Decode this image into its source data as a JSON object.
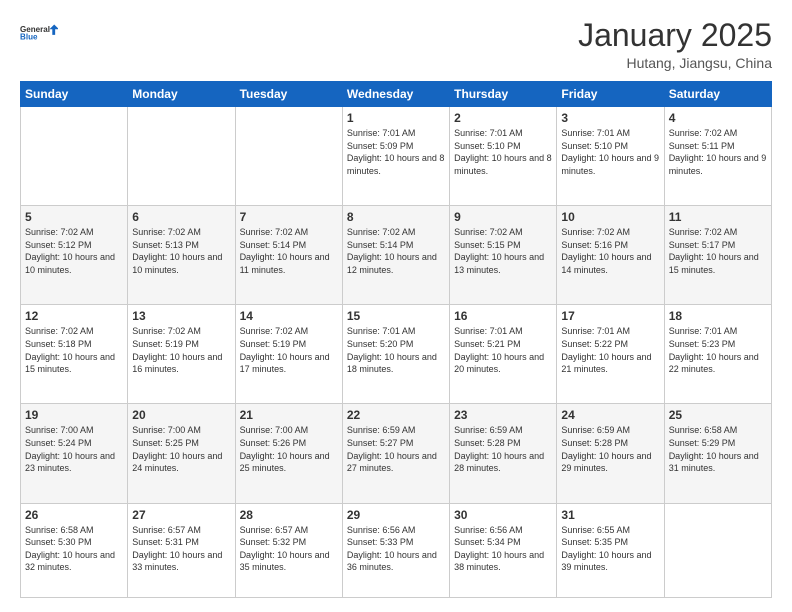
{
  "header": {
    "logo_text_general": "General",
    "logo_text_blue": "Blue",
    "month": "January 2025",
    "location": "Hutang, Jiangsu, China"
  },
  "days_of_week": [
    "Sunday",
    "Monday",
    "Tuesday",
    "Wednesday",
    "Thursday",
    "Friday",
    "Saturday"
  ],
  "weeks": [
    [
      {
        "num": "",
        "info": ""
      },
      {
        "num": "",
        "info": ""
      },
      {
        "num": "",
        "info": ""
      },
      {
        "num": "1",
        "info": "Sunrise: 7:01 AM\nSunset: 5:09 PM\nDaylight: 10 hours and 8 minutes."
      },
      {
        "num": "2",
        "info": "Sunrise: 7:01 AM\nSunset: 5:10 PM\nDaylight: 10 hours and 8 minutes."
      },
      {
        "num": "3",
        "info": "Sunrise: 7:01 AM\nSunset: 5:10 PM\nDaylight: 10 hours and 9 minutes."
      },
      {
        "num": "4",
        "info": "Sunrise: 7:02 AM\nSunset: 5:11 PM\nDaylight: 10 hours and 9 minutes."
      }
    ],
    [
      {
        "num": "5",
        "info": "Sunrise: 7:02 AM\nSunset: 5:12 PM\nDaylight: 10 hours and 10 minutes."
      },
      {
        "num": "6",
        "info": "Sunrise: 7:02 AM\nSunset: 5:13 PM\nDaylight: 10 hours and 10 minutes."
      },
      {
        "num": "7",
        "info": "Sunrise: 7:02 AM\nSunset: 5:14 PM\nDaylight: 10 hours and 11 minutes."
      },
      {
        "num": "8",
        "info": "Sunrise: 7:02 AM\nSunset: 5:14 PM\nDaylight: 10 hours and 12 minutes."
      },
      {
        "num": "9",
        "info": "Sunrise: 7:02 AM\nSunset: 5:15 PM\nDaylight: 10 hours and 13 minutes."
      },
      {
        "num": "10",
        "info": "Sunrise: 7:02 AM\nSunset: 5:16 PM\nDaylight: 10 hours and 14 minutes."
      },
      {
        "num": "11",
        "info": "Sunrise: 7:02 AM\nSunset: 5:17 PM\nDaylight: 10 hours and 15 minutes."
      }
    ],
    [
      {
        "num": "12",
        "info": "Sunrise: 7:02 AM\nSunset: 5:18 PM\nDaylight: 10 hours and 15 minutes."
      },
      {
        "num": "13",
        "info": "Sunrise: 7:02 AM\nSunset: 5:19 PM\nDaylight: 10 hours and 16 minutes."
      },
      {
        "num": "14",
        "info": "Sunrise: 7:02 AM\nSunset: 5:19 PM\nDaylight: 10 hours and 17 minutes."
      },
      {
        "num": "15",
        "info": "Sunrise: 7:01 AM\nSunset: 5:20 PM\nDaylight: 10 hours and 18 minutes."
      },
      {
        "num": "16",
        "info": "Sunrise: 7:01 AM\nSunset: 5:21 PM\nDaylight: 10 hours and 20 minutes."
      },
      {
        "num": "17",
        "info": "Sunrise: 7:01 AM\nSunset: 5:22 PM\nDaylight: 10 hours and 21 minutes."
      },
      {
        "num": "18",
        "info": "Sunrise: 7:01 AM\nSunset: 5:23 PM\nDaylight: 10 hours and 22 minutes."
      }
    ],
    [
      {
        "num": "19",
        "info": "Sunrise: 7:00 AM\nSunset: 5:24 PM\nDaylight: 10 hours and 23 minutes."
      },
      {
        "num": "20",
        "info": "Sunrise: 7:00 AM\nSunset: 5:25 PM\nDaylight: 10 hours and 24 minutes."
      },
      {
        "num": "21",
        "info": "Sunrise: 7:00 AM\nSunset: 5:26 PM\nDaylight: 10 hours and 25 minutes."
      },
      {
        "num": "22",
        "info": "Sunrise: 6:59 AM\nSunset: 5:27 PM\nDaylight: 10 hours and 27 minutes."
      },
      {
        "num": "23",
        "info": "Sunrise: 6:59 AM\nSunset: 5:28 PM\nDaylight: 10 hours and 28 minutes."
      },
      {
        "num": "24",
        "info": "Sunrise: 6:59 AM\nSunset: 5:28 PM\nDaylight: 10 hours and 29 minutes."
      },
      {
        "num": "25",
        "info": "Sunrise: 6:58 AM\nSunset: 5:29 PM\nDaylight: 10 hours and 31 minutes."
      }
    ],
    [
      {
        "num": "26",
        "info": "Sunrise: 6:58 AM\nSunset: 5:30 PM\nDaylight: 10 hours and 32 minutes."
      },
      {
        "num": "27",
        "info": "Sunrise: 6:57 AM\nSunset: 5:31 PM\nDaylight: 10 hours and 33 minutes."
      },
      {
        "num": "28",
        "info": "Sunrise: 6:57 AM\nSunset: 5:32 PM\nDaylight: 10 hours and 35 minutes."
      },
      {
        "num": "29",
        "info": "Sunrise: 6:56 AM\nSunset: 5:33 PM\nDaylight: 10 hours and 36 minutes."
      },
      {
        "num": "30",
        "info": "Sunrise: 6:56 AM\nSunset: 5:34 PM\nDaylight: 10 hours and 38 minutes."
      },
      {
        "num": "31",
        "info": "Sunrise: 6:55 AM\nSunset: 5:35 PM\nDaylight: 10 hours and 39 minutes."
      },
      {
        "num": "",
        "info": ""
      }
    ]
  ]
}
